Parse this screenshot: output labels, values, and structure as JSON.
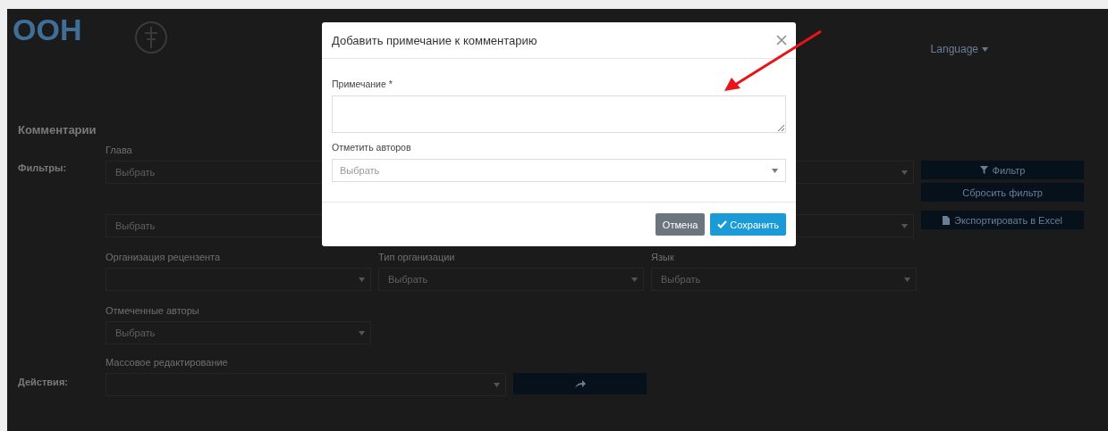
{
  "header": {
    "logo_text": "ООН",
    "nav": [
      {
        "label": "Language"
      }
    ]
  },
  "page": {
    "title": "Комментарии",
    "filters_label": "Фильтры:",
    "filter_rows": [
      {
        "fields": [
          {
            "label": "Глава",
            "placeholder": "Выбрать"
          }
        ]
      },
      {
        "fields": [
          {
            "placeholder": "Выбрать"
          }
        ]
      },
      {
        "fields": [
          {
            "label": "Организация рецензента"
          },
          {
            "label": "Тип организации",
            "placeholder": "Выбрать"
          },
          {
            "label": "Язык",
            "placeholder": "Выбрать"
          }
        ]
      },
      {
        "fields": [
          {
            "label": "Отмеченные авторы",
            "placeholder": "Выбрать"
          }
        ]
      }
    ],
    "filter_buttons": [
      {
        "label": "Фильтр"
      },
      {
        "label": "Сбросить фильтр"
      },
      {
        "label": "Экспортировать в Excel"
      }
    ],
    "bulk_label": "Массовое редактирование",
    "actions_label": "Действия:"
  },
  "modal": {
    "title": "Добавить примечание к комментарию",
    "fields": [
      {
        "kind": "textarea",
        "label": "Примечание *"
      },
      {
        "kind": "select",
        "label": "Отметить авторов",
        "placeholder": "Выбрать"
      }
    ],
    "buttons": [
      {
        "kind": "secondary",
        "label": "Отмена"
      },
      {
        "kind": "primary",
        "label": "Сохранить"
      }
    ]
  }
}
